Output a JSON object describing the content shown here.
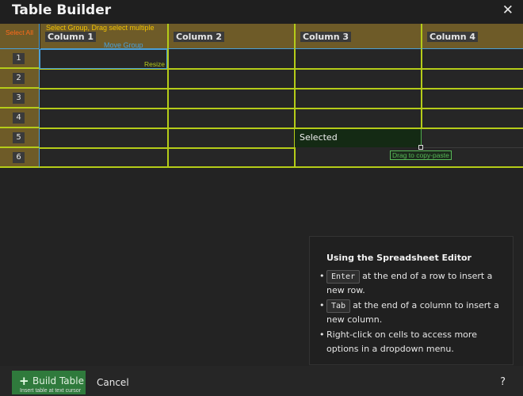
{
  "window": {
    "title": "Table Builder",
    "close_glyph": "✕"
  },
  "grid": {
    "select_all": "Select All",
    "hint_group": "Select Group, Drag select multiple",
    "hint_move": "Move Group",
    "hint_resize": "Resize",
    "columns": [
      "Column 1",
      "Column 2",
      "Column 3",
      "Column 4"
    ],
    "rows": [
      "1",
      "2",
      "3",
      "4",
      "5",
      "6"
    ],
    "selected_text": "Selected",
    "drag_hint": "Drag to copy-paste"
  },
  "help": {
    "title": "Using the Spreadsheet Editor",
    "items": [
      {
        "key": "Enter",
        "text": "at the end of a row to insert a new row."
      },
      {
        "key": "Tab",
        "text": "at the end of a column to insert a new column."
      },
      {
        "key": "",
        "text": "Right-click on cells to access more options in a dropdown menu."
      }
    ]
  },
  "footer": {
    "build_label": "Build Table",
    "build_sub": "Insert table at text cursor",
    "cancel_label": "Cancel",
    "help_label": "?"
  },
  "colors": {
    "accent_gold": "#6e5b28",
    "grid_line": "#b5cc18",
    "selection_blue": "#4aa0d8",
    "build_green": "#2f7a3c"
  }
}
